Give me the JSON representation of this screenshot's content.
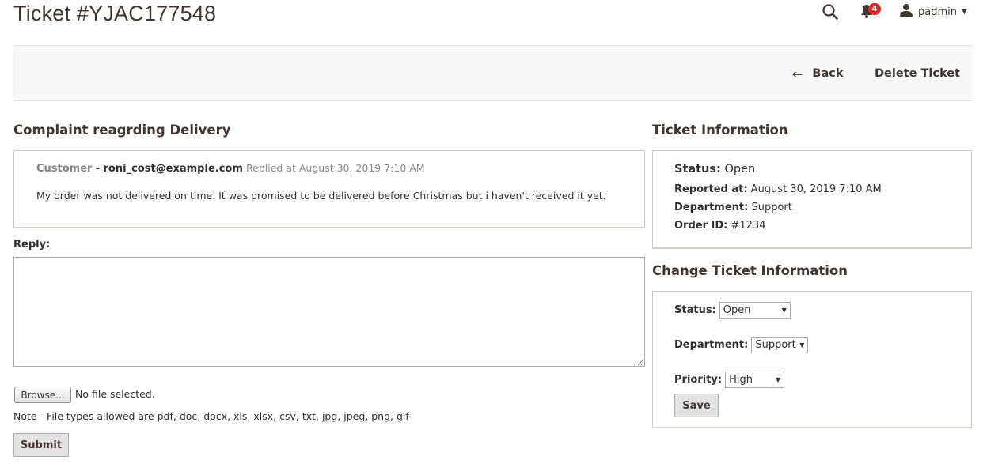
{
  "page": {
    "title": "Ticket #YJAC177548"
  },
  "header": {
    "notification_count": "4",
    "username": "padmin",
    "icons": {
      "search": "search-icon",
      "notifications": "bell-icon",
      "user": "user-icon"
    },
    "badge_color": "#e22626"
  },
  "actions": {
    "back_label": "Back",
    "delete_label": "Delete Ticket"
  },
  "conversation": {
    "title": "Complaint reagrding Delivery",
    "message": {
      "role": "Customer",
      "email": "- roni_cost@example.com",
      "time": "Replied at August 30, 2019 7:10 AM",
      "body": "My order was not delivered on time. It was promised to be delivered before Christmas but i haven't received it yet."
    },
    "reply_label": "Reply:",
    "reply_value": "",
    "browse_label": "Browse...",
    "file_status": "No file selected.",
    "file_note": "Note - File types allowed are pdf, doc, docx, xls, xlsx, csv, txt, jpg, jpeg, png, gif",
    "submit_label": "Submit"
  },
  "ticket_info": {
    "title": "Ticket Information",
    "status_key": "Status:",
    "status_value": "Open",
    "reported_key": "Reported at:",
    "reported_value": "August 30, 2019 7:10 AM",
    "department_key": "Department:",
    "department_value": "Support",
    "order_key": "Order ID:",
    "order_value": "#1234"
  },
  "change_info": {
    "title": "Change Ticket Information",
    "status_label": "Status:",
    "status_selected": "Open",
    "department_label": "Department:",
    "department_selected": "Support",
    "priority_label": "Priority:",
    "priority_selected": "High",
    "save_label": "Save"
  }
}
